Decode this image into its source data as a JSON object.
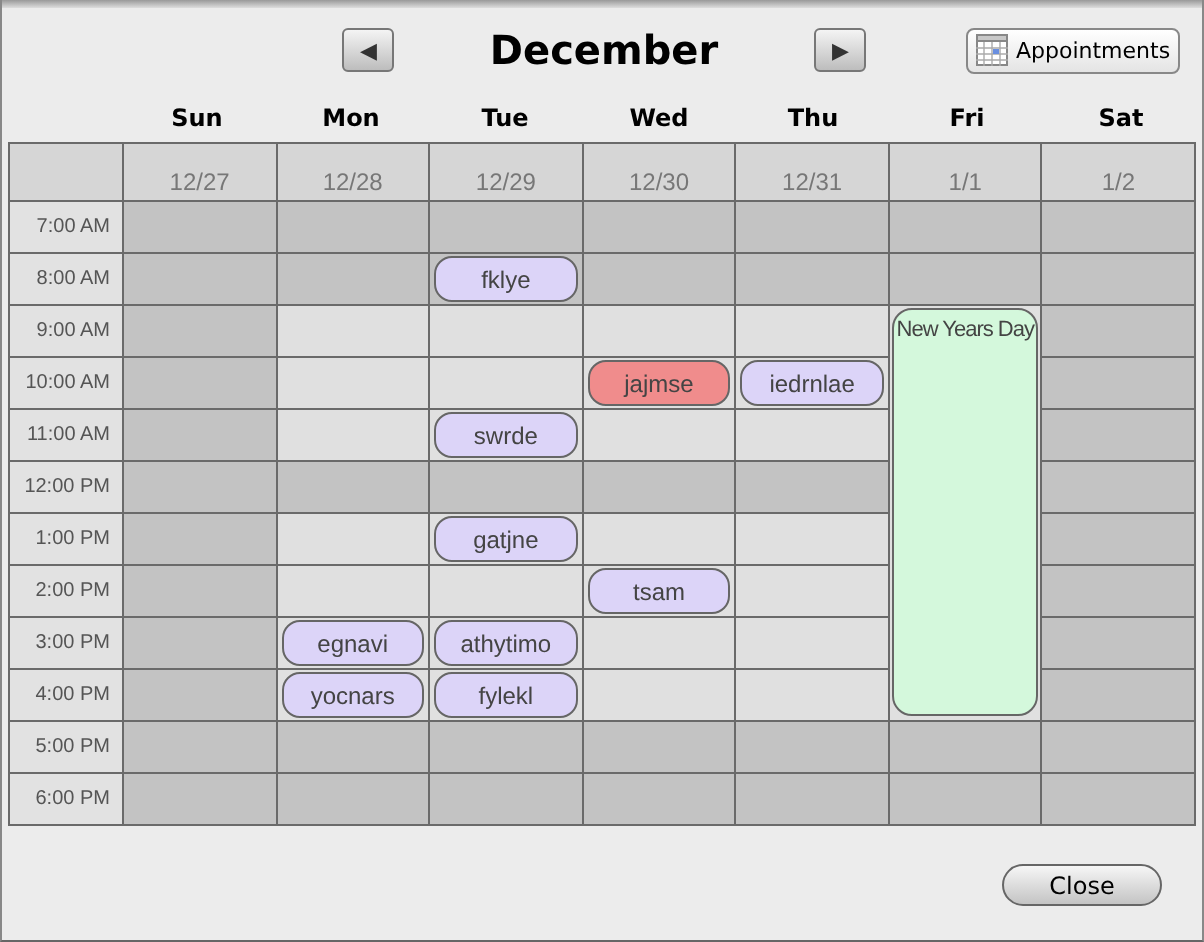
{
  "month": "December",
  "buttons": {
    "previous": "◀",
    "next": "▶",
    "appointments": "Appointments",
    "close": "Close"
  },
  "hours": [
    "7:00 AM",
    "8:00 AM",
    "9:00 AM",
    "10:00 AM",
    "11:00 AM",
    "12:00 PM",
    "1:00 PM",
    "2:00 PM",
    "3:00 PM",
    "4:00 PM",
    "5:00 PM",
    "6:00 PM"
  ],
  "days": [
    {
      "name": "Sun",
      "date": "12/27",
      "slots": [
        {
          "business": false
        },
        {
          "business": false
        },
        {
          "business": false
        },
        {
          "business": false
        },
        {
          "business": false
        },
        {
          "business": false
        },
        {
          "business": false
        },
        {
          "business": false
        },
        {
          "business": false
        },
        {
          "business": false
        },
        {
          "business": false
        },
        {
          "business": false
        }
      ]
    },
    {
      "name": "Mon",
      "date": "12/28",
      "slots": [
        {
          "business": false
        },
        {
          "business": false
        },
        {
          "business": true
        },
        {
          "business": true
        },
        {
          "business": true
        },
        {
          "business": false
        },
        {
          "business": true
        },
        {
          "business": true
        },
        {
          "business": true,
          "event": {
            "kind": "timed",
            "title": "egnavi",
            "color": "#dcd4f8"
          }
        },
        {
          "business": true,
          "event": {
            "kind": "timed",
            "title": "yocnars",
            "color": "#dcd4f8"
          }
        },
        {
          "business": false
        },
        {
          "business": false
        }
      ]
    },
    {
      "name": "Tue",
      "date": "12/29",
      "slots": [
        {
          "business": false
        },
        {
          "business": false,
          "event": {
            "kind": "timed",
            "title": "fklye",
            "color": "#dcd4f8"
          }
        },
        {
          "business": true
        },
        {
          "business": true
        },
        {
          "business": true,
          "event": {
            "kind": "timed",
            "title": "swrde",
            "color": "#dcd4f8"
          }
        },
        {
          "business": false
        },
        {
          "business": true,
          "event": {
            "kind": "timed",
            "title": "gatjne",
            "color": "#dcd4f8"
          }
        },
        {
          "business": true
        },
        {
          "business": true,
          "event": {
            "kind": "timed",
            "title": "athytimo",
            "color": "#dcd4f8"
          }
        },
        {
          "business": true,
          "event": {
            "kind": "timed",
            "title": "fylekl",
            "color": "#dcd4f8"
          }
        },
        {
          "business": false
        },
        {
          "business": false
        }
      ]
    },
    {
      "name": "Wed",
      "date": "12/30",
      "slots": [
        {
          "business": false
        },
        {
          "business": false
        },
        {
          "business": true
        },
        {
          "business": true,
          "event": {
            "kind": "timed",
            "title": "jajmse",
            "color": "#f08c8c"
          }
        },
        {
          "business": true
        },
        {
          "business": false
        },
        {
          "business": true
        },
        {
          "business": true,
          "event": {
            "kind": "timed",
            "title": "tsam",
            "color": "#dcd4f8"
          }
        },
        {
          "business": true
        },
        {
          "business": true
        },
        {
          "business": false
        },
        {
          "business": false
        }
      ]
    },
    {
      "name": "Thu",
      "date": "12/31",
      "slots": [
        {
          "business": false
        },
        {
          "business": false
        },
        {
          "business": true
        },
        {
          "business": true,
          "event": {
            "kind": "timed",
            "title": "iedrnlae",
            "color": "#dcd4f8"
          }
        },
        {
          "business": true
        },
        {
          "business": false
        },
        {
          "business": true
        },
        {
          "business": true
        },
        {
          "business": true
        },
        {
          "business": true
        },
        {
          "business": false
        },
        {
          "business": false
        }
      ]
    },
    {
      "name": "Fri",
      "date": "1/1",
      "slots": [
        {
          "business": false
        },
        {
          "business": false
        },
        {
          "business": true,
          "event": {
            "kind": "all_day",
            "title": "New Years Day",
            "color": "#d4f8dc"
          }
        },
        {
          "business": false
        },
        {
          "business": false
        }
      ]
    },
    {
      "name": "Sat",
      "date": "1/2",
      "slots": [
        {
          "business": false
        },
        {
          "business": false
        },
        {
          "business": false
        },
        {
          "business": false
        },
        {
          "business": false
        },
        {
          "business": false
        },
        {
          "business": false
        },
        {
          "business": false
        },
        {
          "business": false
        },
        {
          "business": false
        },
        {
          "business": false
        },
        {
          "business": false
        }
      ]
    }
  ]
}
